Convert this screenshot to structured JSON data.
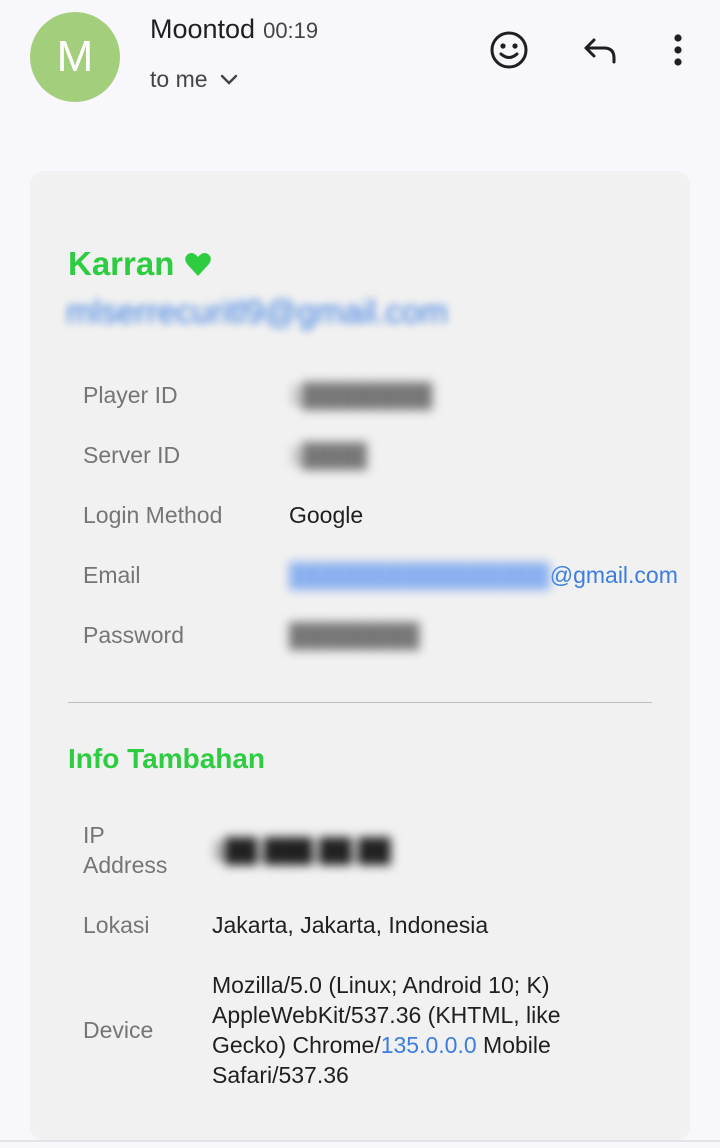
{
  "header": {
    "avatar_letter": "M",
    "sender": "Moontod",
    "time": "00:19",
    "to": "to me",
    "avatar_color": "#a3cf7d"
  },
  "card": {
    "name": "Karran",
    "name_color": "#2ecc40",
    "email_blurred": "mlserrecuritl9@gmail.com",
    "rows": [
      {
        "label": "Player ID",
        "value": "1████████"
      },
      {
        "label": "Server ID",
        "value": "1████"
      },
      {
        "label": "Login Method",
        "value": "Google"
      },
      {
        "label": "Email",
        "value_hidden": "████████████████",
        "value_visible": "@gmail.com"
      },
      {
        "label": "Password",
        "value": "████████"
      }
    ],
    "section_title": "Info Tambahan",
    "info": {
      "ip_label_1": "IP",
      "ip_label_2": "Address",
      "ip_value": "1██.███.██.██",
      "lokasi_label": "Lokasi",
      "lokasi_value": "Jakarta, Jakarta, Indonesia",
      "device_label": "Device",
      "device_line1": "Mozilla/5.0 (Linux; Android 10; K)",
      "device_line2": "AppleWebKit/537.36 (KHTML, like",
      "device_line3a": "Gecko) Chrome/",
      "device_line3_link": "135.0.0.0",
      "device_line3b": " Mobile",
      "device_line4": "Safari/537.36"
    }
  }
}
